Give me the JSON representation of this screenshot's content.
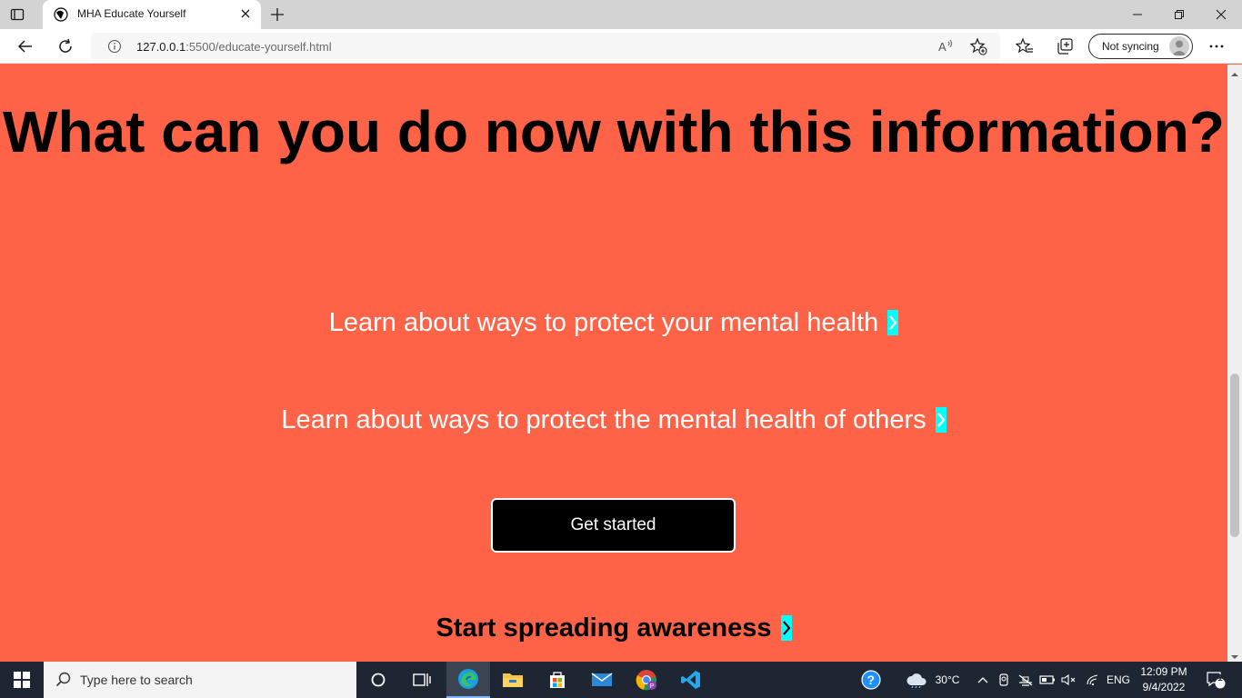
{
  "browser": {
    "tab_title": "MHA Educate Yourself",
    "url_host": "127.0.0.1",
    "url_rest": ":5500/educate-yourself.html",
    "sync_label": "Not syncing"
  },
  "page": {
    "heading": "What can you do now with this information?",
    "link_1": "Learn about ways to protect your mental health",
    "link_2": "Learn about ways to protect the mental health of others",
    "cta_label": "Get started",
    "link_3": "Start spreading awareness",
    "colors": {
      "background": "#ff6347",
      "chevron_accent": "#00ffff",
      "button": "#000000"
    }
  },
  "taskbar": {
    "search_placeholder": "Type here to search",
    "temperature": "30°C",
    "language": "ENG",
    "time": "12:09 PM",
    "date": "9/4/2022",
    "notification_count": "1",
    "apps": [
      "cortana-icon",
      "task-view-icon",
      "edge-icon",
      "file-explorer-icon",
      "store-icon",
      "mail-icon",
      "chrome-icon",
      "vscode-icon"
    ]
  }
}
